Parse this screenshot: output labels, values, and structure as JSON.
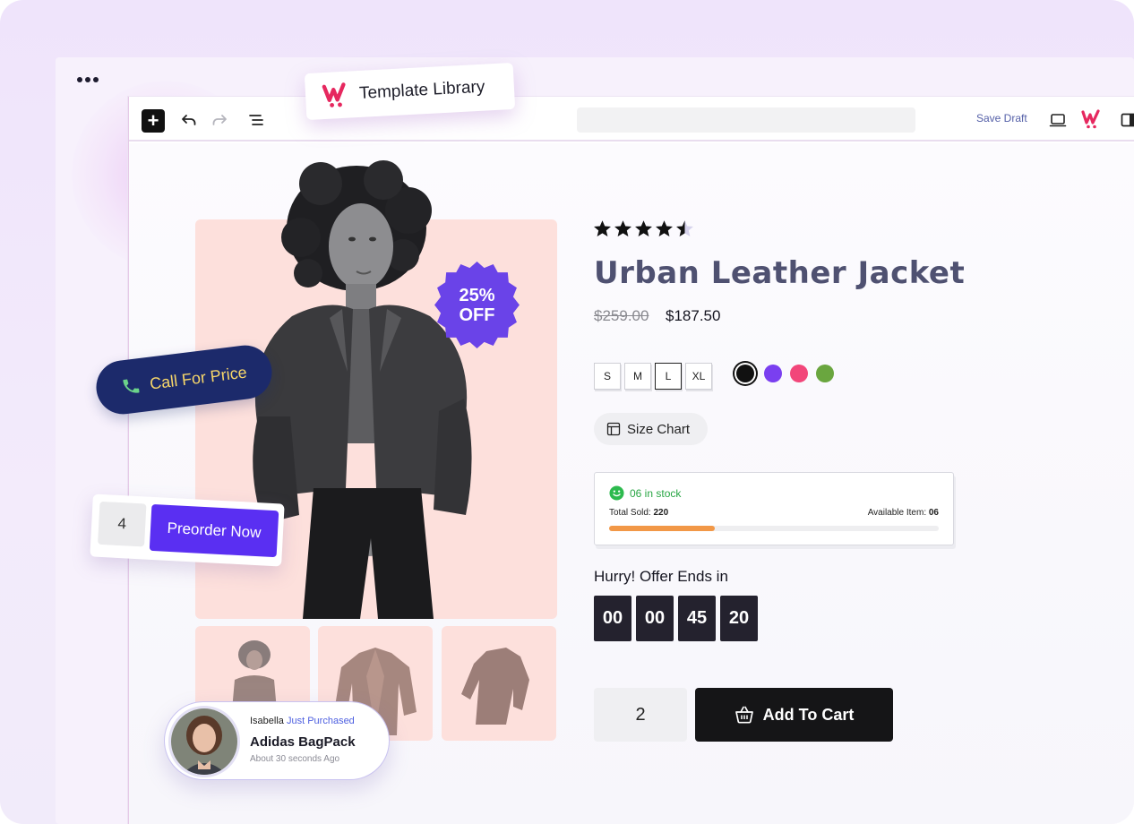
{
  "colors": {
    "accent_purple": "#5a2ff2",
    "brand_pink": "#e6285f",
    "title_slate": "#4f5171",
    "call_navy": "#1c2a6b",
    "call_text": "#f6d66a",
    "stock_green": "#27a543",
    "progress_orange": "#f29847",
    "badge_purple": "#6a43e8"
  },
  "template_library": {
    "label": "Template Library",
    "icon": "wowstore-logo-icon"
  },
  "toolbar": {
    "icons": [
      "plus-icon",
      "undo-icon",
      "redo-icon",
      "list-view-icon",
      "desktop-preview-icon",
      "wowstore-logo-icon",
      "settings-panel-icon"
    ],
    "save_label": "Save Draft"
  },
  "product": {
    "rating": 4.5,
    "rating_max": 5,
    "title": "Urban Leather Jacket",
    "price_old": "$259.00",
    "price_new": "$187.50",
    "discount_line1": "25%",
    "discount_line2": "OFF",
    "sizes": [
      "S",
      "M",
      "L",
      "XL"
    ],
    "selected_size": "L",
    "colors": [
      "#111111",
      "#7a3ff0",
      "#f2467a",
      "#6aa63f"
    ],
    "selected_color_index": 0,
    "size_chart_label": "Size Chart"
  },
  "stock": {
    "status": "06 in stock",
    "sold_label": "Total Sold:",
    "sold_value": "220",
    "available_label": "Available Item:",
    "available_value": "06",
    "progress_fraction": 0.32
  },
  "countdown": {
    "label": "Hurry! Offer Ends in",
    "cells": [
      "00",
      "00",
      "45",
      "20"
    ]
  },
  "cart": {
    "quantity": "2",
    "button_label": "Add To Cart"
  },
  "call_for_price": {
    "label": "Call For Price"
  },
  "preorder": {
    "quantity": "4",
    "button_label": "Preorder Now"
  },
  "recent_purchase": {
    "name": "Isabella",
    "action": "Just Purchased",
    "item": "Adidas BagPack",
    "time": "About 30 seconds Ago"
  }
}
